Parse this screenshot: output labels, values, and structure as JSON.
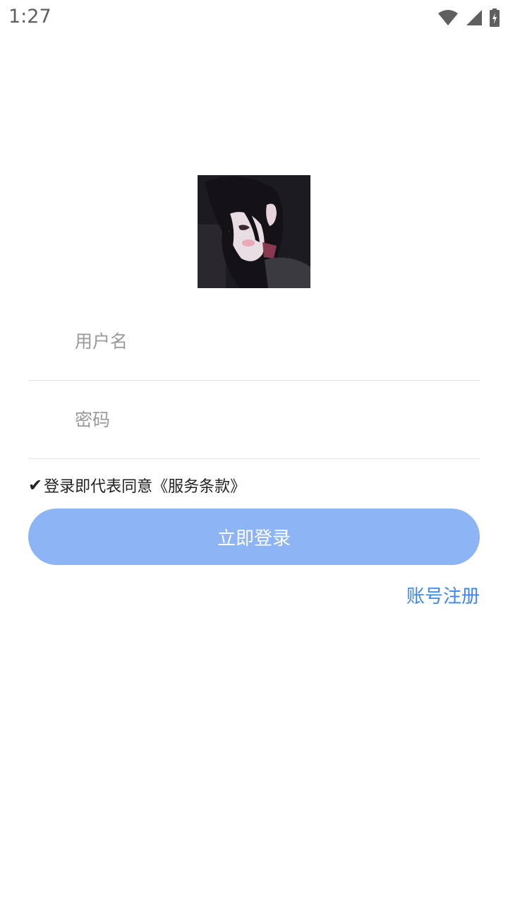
{
  "status_bar": {
    "time": "1:27",
    "icons": [
      "wifi-icon",
      "signal-icon",
      "battery-charging-icon"
    ]
  },
  "logo": {
    "icon": "anime-avatar-image"
  },
  "form": {
    "username_placeholder": "用户名",
    "password_placeholder": "密码",
    "agreement_check": "✔",
    "agreement_text": "登录即代表同意《服务条款》",
    "login_label": "立即登录",
    "register_label": "账号注册"
  },
  "colors": {
    "primary_button": "#8db4f5",
    "link": "#3d86f0",
    "divider": "#e3e3e3"
  }
}
